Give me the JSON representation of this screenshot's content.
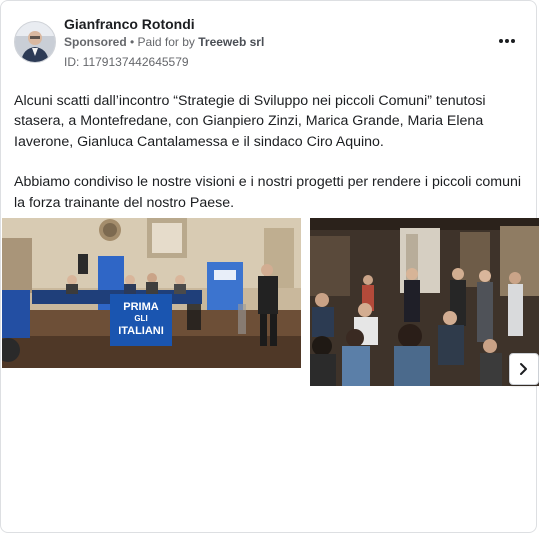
{
  "post": {
    "author": "Gianfranco Rotondi",
    "sponsored_label": "Sponsored",
    "separator": " • ",
    "paid_for_prefix": "Paid for by ",
    "advertiser": "Treeweb srl",
    "ad_id": "ID: 1179137442645579",
    "more_icon": "more-horizontal-icon",
    "paragraphs": [
      "Alcuni scatti dall’incontro “Strategie di Sviluppo nei piccoli Comuni” tenutosi stasera, a Montefredane, con Gianpiero Zinzi, Marica Grande, Maria Elena Iaverone, Gianluca Cantalamessa e il sindaco Ciro Aquino.",
      "Abbiamo condiviso le nostre visioni e i nostri progetti per rendere i piccoli comuni la forza trainante del nostro Paese."
    ]
  },
  "carousel": {
    "banner_line1": "PRIMA",
    "banner_line2": "GLI",
    "banner_line3": "ITALIANI",
    "next_icon": "chevron-right-icon"
  },
  "colors": {
    "banner_blue": "#1a55b0",
    "text_primary": "#1c1e21",
    "text_secondary": "#65676b",
    "card_border": "#dddfe2"
  }
}
